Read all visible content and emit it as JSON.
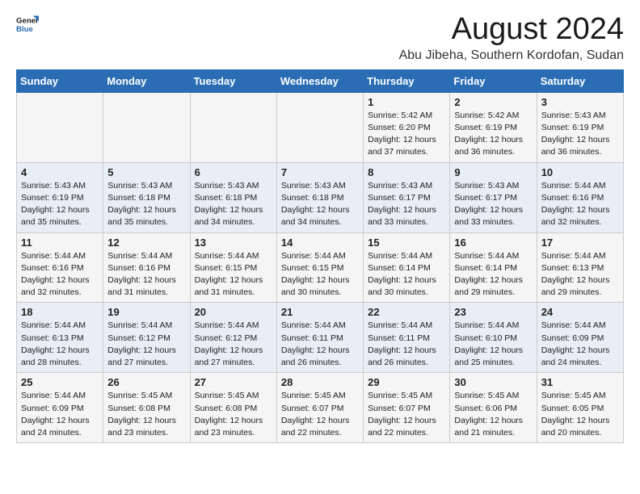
{
  "logo": {
    "line1": "General",
    "line2": "Blue"
  },
  "header": {
    "month": "August 2024",
    "location": "Abu Jibeha, Southern Kordofan, Sudan"
  },
  "days_of_week": [
    "Sunday",
    "Monday",
    "Tuesday",
    "Wednesday",
    "Thursday",
    "Friday",
    "Saturday"
  ],
  "weeks": [
    [
      {
        "day": "",
        "info": ""
      },
      {
        "day": "",
        "info": ""
      },
      {
        "day": "",
        "info": ""
      },
      {
        "day": "",
        "info": ""
      },
      {
        "day": "1",
        "info": "Sunrise: 5:42 AM\nSunset: 6:20 PM\nDaylight: 12 hours\nand 37 minutes."
      },
      {
        "day": "2",
        "info": "Sunrise: 5:42 AM\nSunset: 6:19 PM\nDaylight: 12 hours\nand 36 minutes."
      },
      {
        "day": "3",
        "info": "Sunrise: 5:43 AM\nSunset: 6:19 PM\nDaylight: 12 hours\nand 36 minutes."
      }
    ],
    [
      {
        "day": "4",
        "info": "Sunrise: 5:43 AM\nSunset: 6:19 PM\nDaylight: 12 hours\nand 35 minutes."
      },
      {
        "day": "5",
        "info": "Sunrise: 5:43 AM\nSunset: 6:18 PM\nDaylight: 12 hours\nand 35 minutes."
      },
      {
        "day": "6",
        "info": "Sunrise: 5:43 AM\nSunset: 6:18 PM\nDaylight: 12 hours\nand 34 minutes."
      },
      {
        "day": "7",
        "info": "Sunrise: 5:43 AM\nSunset: 6:18 PM\nDaylight: 12 hours\nand 34 minutes."
      },
      {
        "day": "8",
        "info": "Sunrise: 5:43 AM\nSunset: 6:17 PM\nDaylight: 12 hours\nand 33 minutes."
      },
      {
        "day": "9",
        "info": "Sunrise: 5:43 AM\nSunset: 6:17 PM\nDaylight: 12 hours\nand 33 minutes."
      },
      {
        "day": "10",
        "info": "Sunrise: 5:44 AM\nSunset: 6:16 PM\nDaylight: 12 hours\nand 32 minutes."
      }
    ],
    [
      {
        "day": "11",
        "info": "Sunrise: 5:44 AM\nSunset: 6:16 PM\nDaylight: 12 hours\nand 32 minutes."
      },
      {
        "day": "12",
        "info": "Sunrise: 5:44 AM\nSunset: 6:16 PM\nDaylight: 12 hours\nand 31 minutes."
      },
      {
        "day": "13",
        "info": "Sunrise: 5:44 AM\nSunset: 6:15 PM\nDaylight: 12 hours\nand 31 minutes."
      },
      {
        "day": "14",
        "info": "Sunrise: 5:44 AM\nSunset: 6:15 PM\nDaylight: 12 hours\nand 30 minutes."
      },
      {
        "day": "15",
        "info": "Sunrise: 5:44 AM\nSunset: 6:14 PM\nDaylight: 12 hours\nand 30 minutes."
      },
      {
        "day": "16",
        "info": "Sunrise: 5:44 AM\nSunset: 6:14 PM\nDaylight: 12 hours\nand 29 minutes."
      },
      {
        "day": "17",
        "info": "Sunrise: 5:44 AM\nSunset: 6:13 PM\nDaylight: 12 hours\nand 29 minutes."
      }
    ],
    [
      {
        "day": "18",
        "info": "Sunrise: 5:44 AM\nSunset: 6:13 PM\nDaylight: 12 hours\nand 28 minutes."
      },
      {
        "day": "19",
        "info": "Sunrise: 5:44 AM\nSunset: 6:12 PM\nDaylight: 12 hours\nand 27 minutes."
      },
      {
        "day": "20",
        "info": "Sunrise: 5:44 AM\nSunset: 6:12 PM\nDaylight: 12 hours\nand 27 minutes."
      },
      {
        "day": "21",
        "info": "Sunrise: 5:44 AM\nSunset: 6:11 PM\nDaylight: 12 hours\nand 26 minutes."
      },
      {
        "day": "22",
        "info": "Sunrise: 5:44 AM\nSunset: 6:11 PM\nDaylight: 12 hours\nand 26 minutes."
      },
      {
        "day": "23",
        "info": "Sunrise: 5:44 AM\nSunset: 6:10 PM\nDaylight: 12 hours\nand 25 minutes."
      },
      {
        "day": "24",
        "info": "Sunrise: 5:44 AM\nSunset: 6:09 PM\nDaylight: 12 hours\nand 24 minutes."
      }
    ],
    [
      {
        "day": "25",
        "info": "Sunrise: 5:44 AM\nSunset: 6:09 PM\nDaylight: 12 hours\nand 24 minutes."
      },
      {
        "day": "26",
        "info": "Sunrise: 5:45 AM\nSunset: 6:08 PM\nDaylight: 12 hours\nand 23 minutes."
      },
      {
        "day": "27",
        "info": "Sunrise: 5:45 AM\nSunset: 6:08 PM\nDaylight: 12 hours\nand 23 minutes."
      },
      {
        "day": "28",
        "info": "Sunrise: 5:45 AM\nSunset: 6:07 PM\nDaylight: 12 hours\nand 22 minutes."
      },
      {
        "day": "29",
        "info": "Sunrise: 5:45 AM\nSunset: 6:07 PM\nDaylight: 12 hours\nand 22 minutes."
      },
      {
        "day": "30",
        "info": "Sunrise: 5:45 AM\nSunset: 6:06 PM\nDaylight: 12 hours\nand 21 minutes."
      },
      {
        "day": "31",
        "info": "Sunrise: 5:45 AM\nSunset: 6:05 PM\nDaylight: 12 hours\nand 20 minutes."
      }
    ]
  ]
}
